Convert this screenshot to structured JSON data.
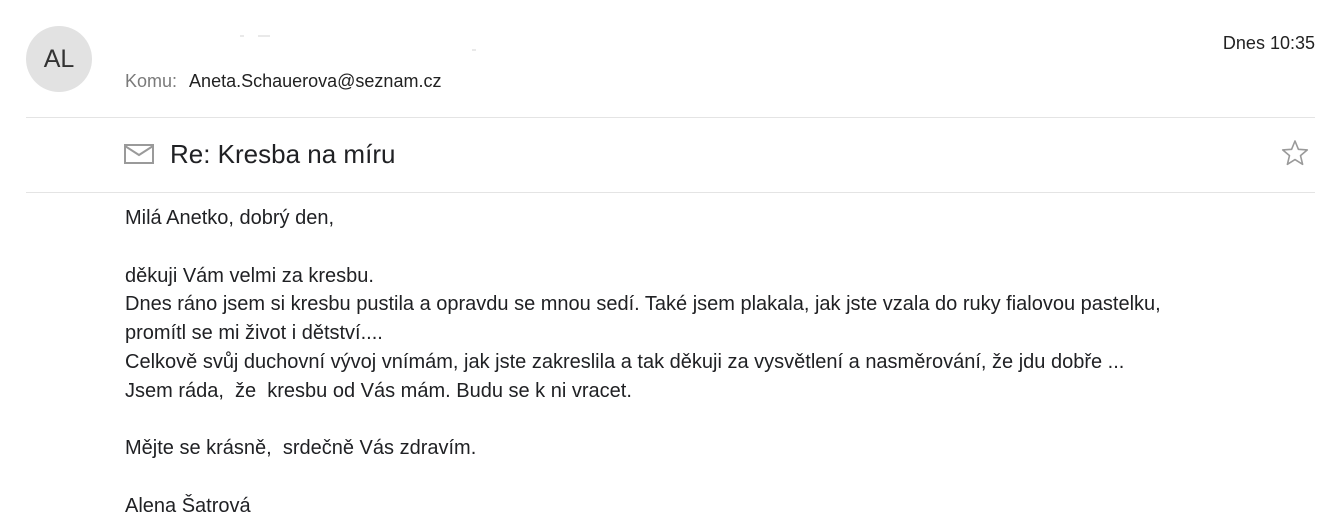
{
  "sender": {
    "avatar_initials": "AL"
  },
  "recipient": {
    "label": "Komu:",
    "address": "Aneta.Schauerova@seznam.cz"
  },
  "date": "Dnes 10:35",
  "subject": "Re: Kresba na míru",
  "icons": {
    "envelope": "envelope-icon",
    "star": "star-icon"
  },
  "body": {
    "greeting": "Milá Anetko, dobrý den,",
    "lines": [
      "děkuji Vám velmi za kresbu.",
      "Dnes ráno jsem si kresbu pustila a opravdu se mnou sedí. Také jsem plakala, jak jste vzala do ruky fialovou pastelku,",
      "promítl se mi život i dětství....",
      "Celkově svůj duchovní vývoj vnímám, jak jste zakreslila a tak děkuji za vysvětlení a nasměrování, že jdu dobře ...",
      "Jsem ráda,  že  kresbu od Vás mám. Budu se k ni vracet."
    ],
    "closing": "Mějte se krásně,  srdečně Vás zdravím.",
    "signature": "Alena Šatrová"
  },
  "colors": {
    "avatar_bg": "#e2e2e2",
    "divider": "#e4e4e4",
    "label_gray": "#7a7a7a",
    "icon_gray": "#9a9a9a"
  }
}
